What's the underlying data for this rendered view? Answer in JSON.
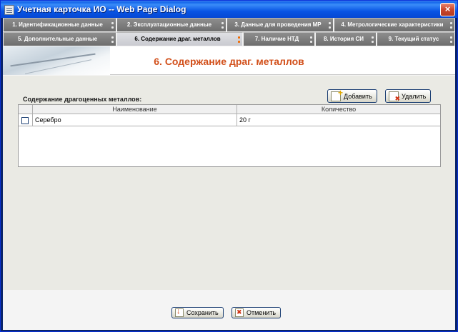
{
  "window": {
    "title": "Учетная карточка ИО -- Web Page Dialog",
    "close_label": "×"
  },
  "tabs_row1": [
    {
      "label": "1. Идентификационные данные"
    },
    {
      "label": "2. Эксплуатационные данные"
    },
    {
      "label": "3. Данные для проведения МР"
    },
    {
      "label": "4. Метрологические характеристики"
    }
  ],
  "tabs_row2": [
    {
      "label": "5. Дополнительные данные"
    },
    {
      "label": "6. Содержание драг. металлов",
      "active": true
    },
    {
      "label": "7. Наличие НТД"
    },
    {
      "label": "8. История СИ"
    },
    {
      "label": "9. Текущий статус"
    }
  ],
  "page": {
    "title": "6. Содержание драг. металлов"
  },
  "section": {
    "label": "Содержание драгоценных металлов:"
  },
  "toolbar": {
    "add_label": "Добавить",
    "delete_label": "Удалить"
  },
  "table": {
    "columns": [
      "Наименование",
      "Количество"
    ],
    "rows": [
      {
        "name": "Серебро",
        "qty": "20 г"
      }
    ]
  },
  "footer": {
    "save_label": "Сохранить",
    "cancel_label": "Отменить"
  }
}
